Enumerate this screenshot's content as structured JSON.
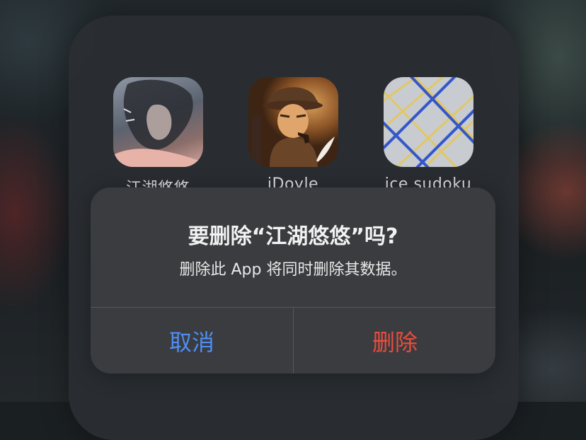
{
  "apps": [
    {
      "label": "江湖悠悠",
      "icon": "jianghu-app-icon"
    },
    {
      "label": "iDoyle",
      "icon": "idoyle-app-icon"
    },
    {
      "label": "ice sudoku",
      "icon": "ice-sudoku-app-icon"
    }
  ],
  "dialog": {
    "title": "要删除“江湖悠悠”吗?",
    "message": "删除此 App 将同时删除其数据。",
    "cancel_label": "取消",
    "delete_label": "删除"
  },
  "colors": {
    "cancel": "#4f8ef2",
    "destructive": "#eb4d3d",
    "dialog_bg": "#3a3c3f"
  }
}
